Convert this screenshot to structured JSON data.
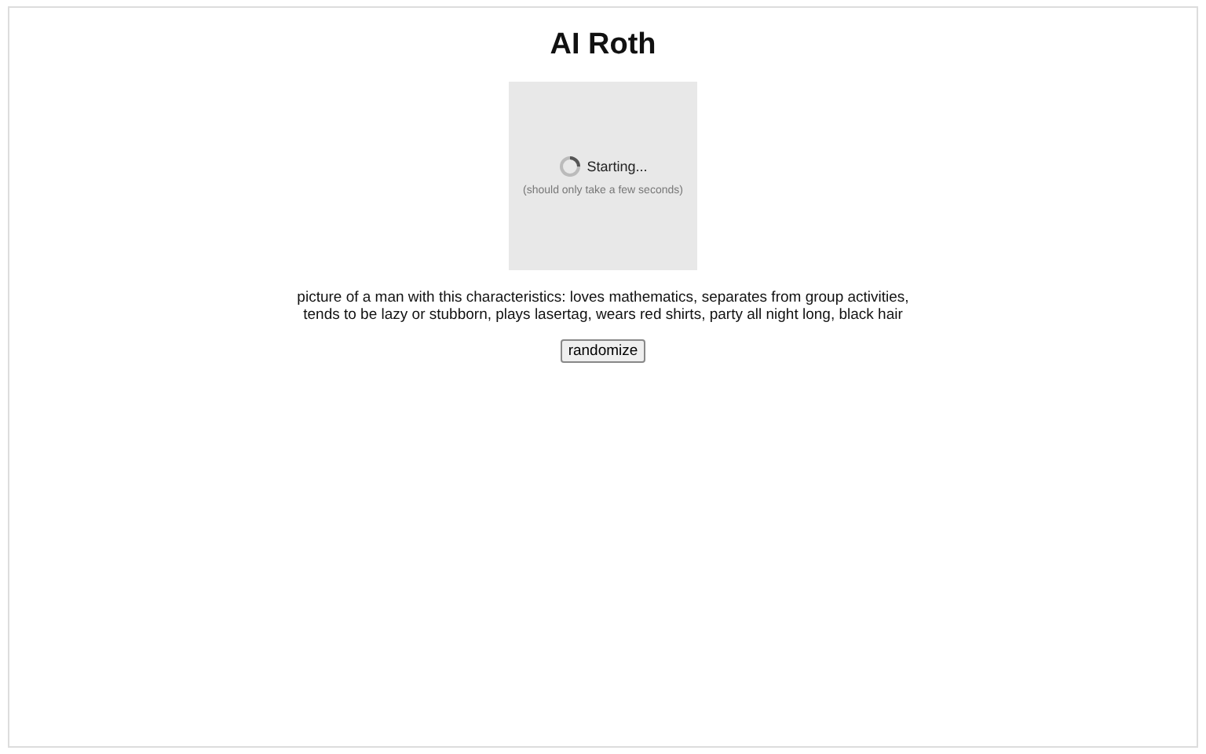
{
  "title": "AI Roth",
  "loader": {
    "status": "Starting...",
    "hint": "(should only take a few seconds)"
  },
  "description": "picture of a man with this characteristics: loves mathematics, separates from group activities, tends to be lazy or stubborn, plays lasertag, wears red shirts, party all night long, black hair",
  "buttons": [
    "randomize"
  ]
}
